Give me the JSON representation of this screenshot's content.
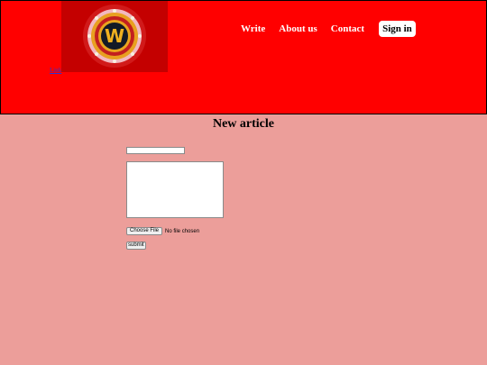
{
  "header": {
    "bg_color": "#ff0000",
    "logo": {
      "letter": "W",
      "icon": "w-coin-logo"
    },
    "home_link": "Link",
    "nav": [
      {
        "label": "Write"
      },
      {
        "label": "About us"
      },
      {
        "label": "Contact"
      }
    ],
    "signin_label": "Sign in"
  },
  "main": {
    "bg_color": "#ec9e9a",
    "title": "New article",
    "title_input": {
      "value": "",
      "placeholder": ""
    },
    "body_textarea": {
      "value": "",
      "placeholder": ""
    },
    "file": {
      "button_label": "Choose File",
      "status": "No file chosen"
    },
    "submit_label": "submit"
  }
}
